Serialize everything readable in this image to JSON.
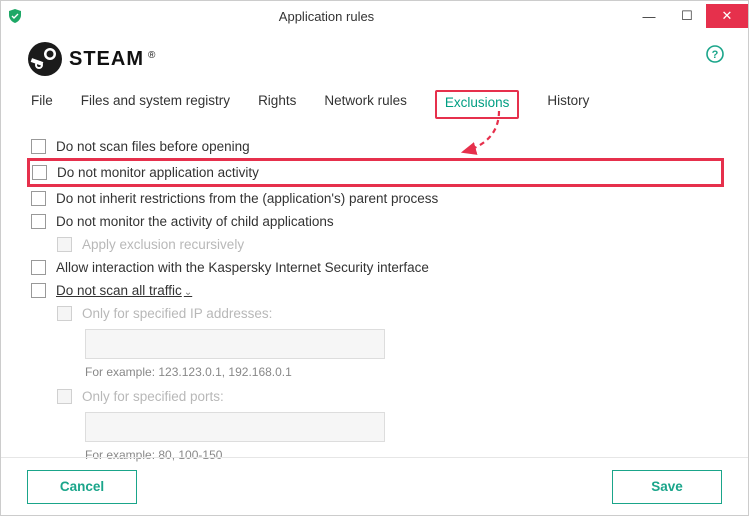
{
  "window": {
    "title": "Application rules"
  },
  "app": {
    "name": "STEAM"
  },
  "tabs": {
    "file": "File",
    "files_registry": "Files and system registry",
    "rights": "Rights",
    "network": "Network rules",
    "exclusions": "Exclusions",
    "history": "History"
  },
  "options": {
    "no_scan_open": "Do not scan files before opening",
    "no_monitor_activity": "Do not monitor application activity",
    "no_inherit": "Do not inherit restrictions from the (application's) parent process",
    "no_monitor_child": "Do not monitor the activity of child applications",
    "apply_recursive": "Apply exclusion recursively",
    "allow_interaction": "Allow interaction with the Kaspersky Internet Security interface",
    "no_scan_all_traffic": "Do not scan all traffic",
    "only_ip": "Only for specified IP addresses:",
    "only_ip_hint": "For example: 123.123.0.1, 192.168.0.1",
    "only_ports": "Only for specified ports:",
    "only_ports_hint": "For example: 80, 100-150"
  },
  "buttons": {
    "cancel": "Cancel",
    "save": "Save"
  },
  "colors": {
    "accent": "#009e82",
    "highlight": "#e6304c"
  }
}
